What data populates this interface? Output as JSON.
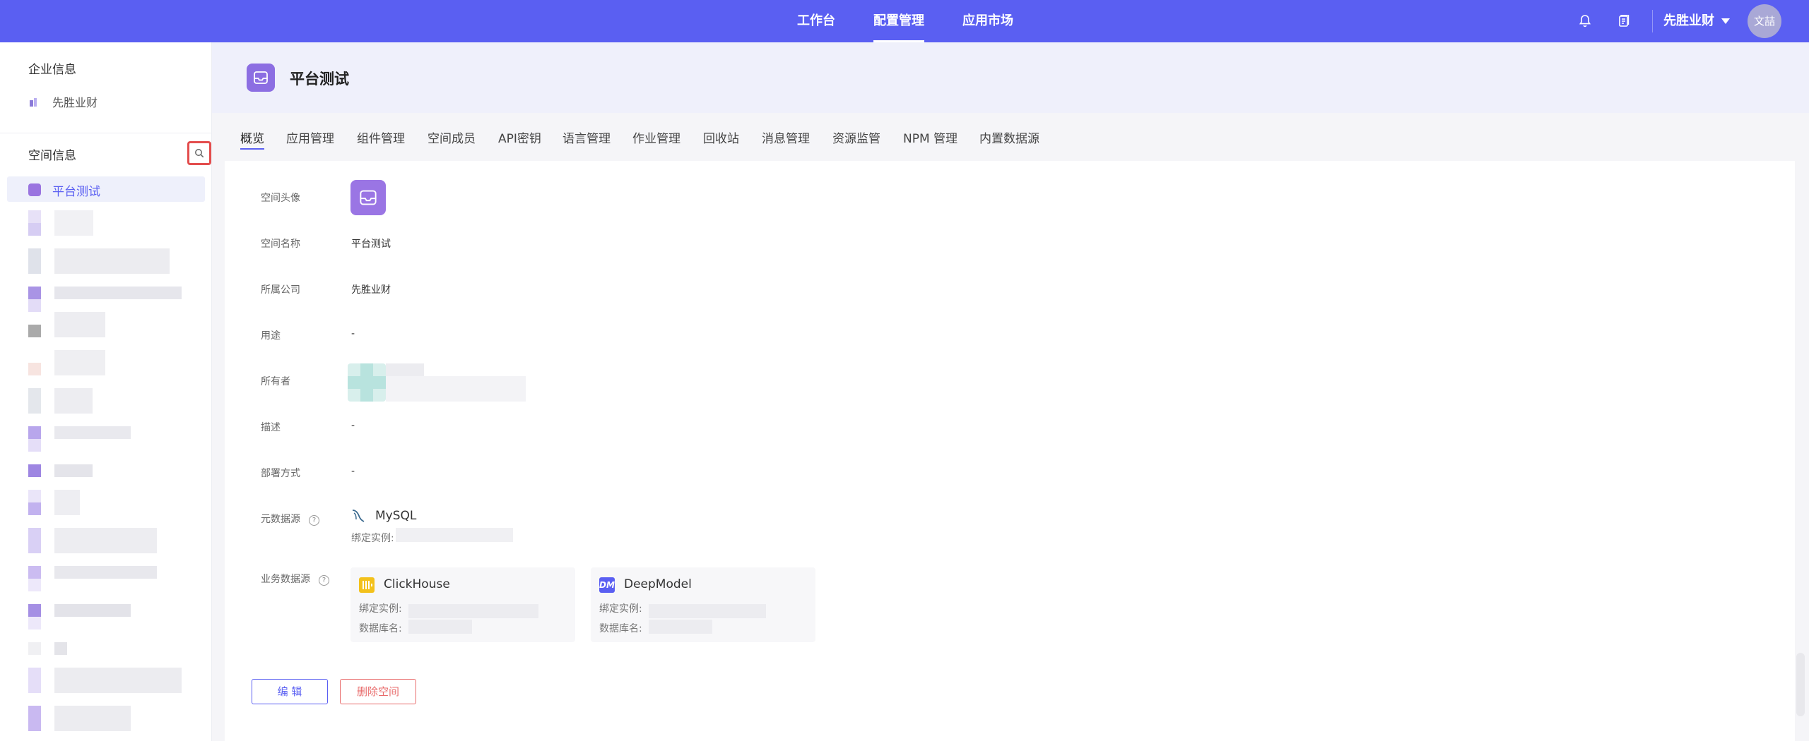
{
  "topbar": {
    "nav": [
      {
        "label": "工作台",
        "active": false
      },
      {
        "label": "配置管理",
        "active": true
      },
      {
        "label": "应用市场",
        "active": false
      }
    ],
    "company": "先胜业财",
    "avatar_text": "文喆"
  },
  "sidebar": {
    "company_section_title": "企业信息",
    "company_name": "先胜业财",
    "space_section_title": "空间信息",
    "active_space": "平台测试"
  },
  "space": {
    "title": "平台测试"
  },
  "tabs": [
    "概览",
    "应用管理",
    "组件管理",
    "空间成员",
    "API密钥",
    "语言管理",
    "作业管理",
    "回收站",
    "消息管理",
    "资源监管",
    "NPM 管理",
    "内置数据源"
  ],
  "fields": {
    "avatar_label": "空间头像",
    "name_label": "空间名称",
    "name_value": "平台测试",
    "company_label": "所属公司",
    "company_value": "先胜业财",
    "usage_label": "用途",
    "usage_value": "-",
    "owner_label": "所有者",
    "desc_label": "描述",
    "desc_value": "-",
    "deploy_label": "部署方式",
    "deploy_value": "-",
    "meta_ds_label": "元数据源",
    "meta_ds_name": "MySQL",
    "meta_ds_instance": "绑定实例:",
    "biz_ds_label": "业务数据源",
    "biz_sources": [
      {
        "name": "ClickHouse",
        "instance_label": "绑定实例:",
        "db_label": "数据库名:",
        "logo_color": "#f3c11b"
      },
      {
        "name": "DeepModel",
        "instance_label": "绑定实例:",
        "db_label": "数据库名:",
        "logo_text": "DM",
        "logo_color": "#5a5ff2"
      }
    ]
  },
  "actions": {
    "edit": "编 辑",
    "delete": "删除空间"
  },
  "colors": {
    "primary": "#5a5ff2",
    "space_icon": "#8c6ee2",
    "danger": "#e86a6a"
  }
}
